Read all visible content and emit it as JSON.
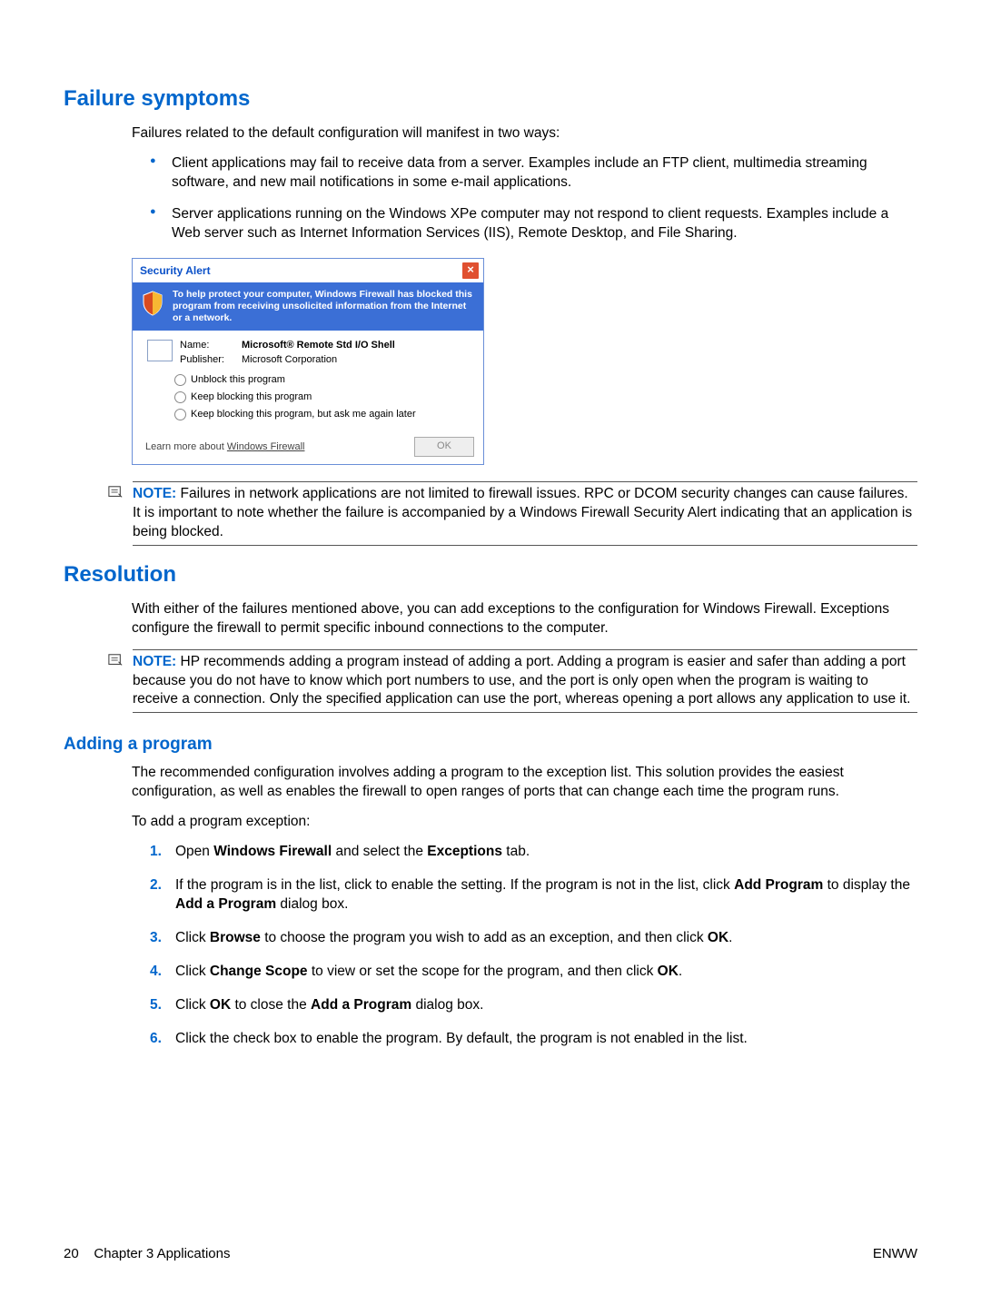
{
  "headings": {
    "h1": "Failure symptoms",
    "h2": "Resolution",
    "h3": "Adding a program"
  },
  "intro": "Failures related to the default configuration will manifest in two ways:",
  "bullets": [
    "Client applications may fail to receive data from a server. Examples include an FTP client, multimedia streaming software, and new mail notifications in some e-mail applications.",
    "Server applications running on the Windows XPe computer may not respond to client requests. Examples include a Web server such as Internet Information Services (IIS), Remote Desktop, and File Sharing."
  ],
  "dialog": {
    "title": "Security Alert",
    "banner": "To help protect your computer, Windows Firewall has blocked this program from receiving unsolicited information from the Internet or a network.",
    "name_label": "Name:",
    "name_value": "Microsoft® Remote Std I/O Shell",
    "publisher_label": "Publisher:",
    "publisher_value": "Microsoft Corporation",
    "radio1": "Unblock this program",
    "radio2": "Keep blocking this program",
    "radio3": "Keep blocking this program, but ask me again later",
    "learn_prefix": "Learn more about ",
    "learn_link": "Windows Firewall",
    "ok": "OK"
  },
  "note1_label": "NOTE:",
  "note1_text": "Failures in network applications are not limited to firewall issues. RPC or DCOM security changes can cause failures. It is important to note whether the failure is accompanied by a Windows Firewall Security Alert indicating that an application is being blocked.",
  "resolution_intro": "With either of the failures mentioned above, you can add exceptions to the configuration for Windows Firewall. Exceptions configure the firewall to permit specific inbound connections to the computer.",
  "note2_label": "NOTE:",
  "note2_text": "HP recommends adding a program instead of adding a port. Adding a program is easier and safer than adding a port because you do not have to know which port numbers to use, and the port is only open when the program is waiting to receive a connection. Only the specified application can use the port, whereas opening a port allows any application to use it.",
  "adding_intro": "The recommended configuration involves adding a program to the exception list. This solution provides the easiest configuration, as well as enables the firewall to open ranges of ports that can change each time the program runs.",
  "adding_lead": "To add a program exception:",
  "steps_html": [
    "Open <b>Windows Firewall</b> and select the <b>Exceptions</b> tab.",
    "If the program is in the list, click to enable the setting. If the program is not in the list, click <b>Add Program</b> to display the <b>Add a Program</b> dialog box.",
    "Click <b>Browse</b> to choose the program you wish to add as an exception, and then click <b>OK</b>.",
    "Click <b>Change Scope</b> to view or set the scope for the program, and then click <b>OK</b>.",
    "Click <b>OK</b> to close the <b>Add a Program</b> dialog box.",
    "Click the check box to enable the program. By default, the program is not enabled in the list."
  ],
  "footer": {
    "page_num": "20",
    "chapter": "Chapter 3   Applications",
    "enww": "ENWW"
  }
}
